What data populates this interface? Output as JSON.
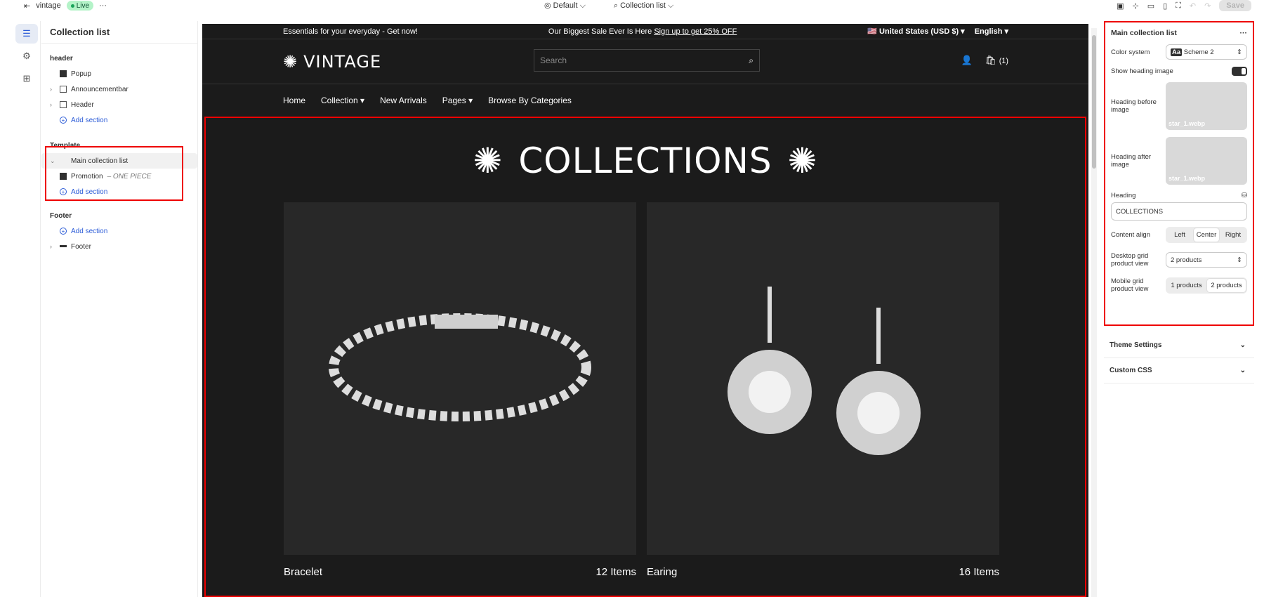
{
  "topbar": {
    "store": "vintage",
    "status": "Live",
    "theme": "Default",
    "template": "Collection list",
    "save": "Save"
  },
  "left": {
    "title": "Collection list",
    "header_group": "header",
    "header_items": [
      "Popup",
      "Announcementbar",
      "Header"
    ],
    "add": "Add section",
    "template_group": "Template",
    "main": "Main collection list",
    "promo": "Promotion",
    "promo_sub": "– ONE PIECE",
    "footer_group": "Footer",
    "footer_item": "Footer"
  },
  "preview": {
    "ann_left": "Essentials for your everyday - Get now!",
    "ann_mid": "Our Biggest Sale Ever Is Here ",
    "ann_link": "Sign up to get 25% OFF",
    "currency": "United States (USD $)",
    "language": "English",
    "logo": "VINTAGE",
    "search_placeholder": "Search",
    "cart_count": "(1)",
    "nav": [
      "Home",
      "Collection",
      "New Arrivals",
      "Pages",
      "Browse By Categories"
    ],
    "heading": "COLLECTIONS",
    "cards": [
      {
        "name": "Bracelet",
        "count": "12 Items"
      },
      {
        "name": "Earing",
        "count": "16 Items"
      }
    ]
  },
  "right": {
    "title": "Main collection list",
    "color_label": "Color system",
    "color_value": "Scheme 2",
    "show_heading": "Show heading image",
    "before": "Heading before image",
    "after": "Heading after image",
    "img_name": "star_1.webp",
    "heading_label": "Heading",
    "heading_value": "COLLECTIONS",
    "align_label": "Content align",
    "align": [
      "Left",
      "Center",
      "Right"
    ],
    "desktop_label": "Desktop grid product view",
    "desktop_value": "2 products",
    "mobile_label": "Mobile grid product view",
    "mobile": [
      "1 products",
      "2 products"
    ],
    "theme_settings": "Theme Settings",
    "custom_css": "Custom CSS"
  }
}
